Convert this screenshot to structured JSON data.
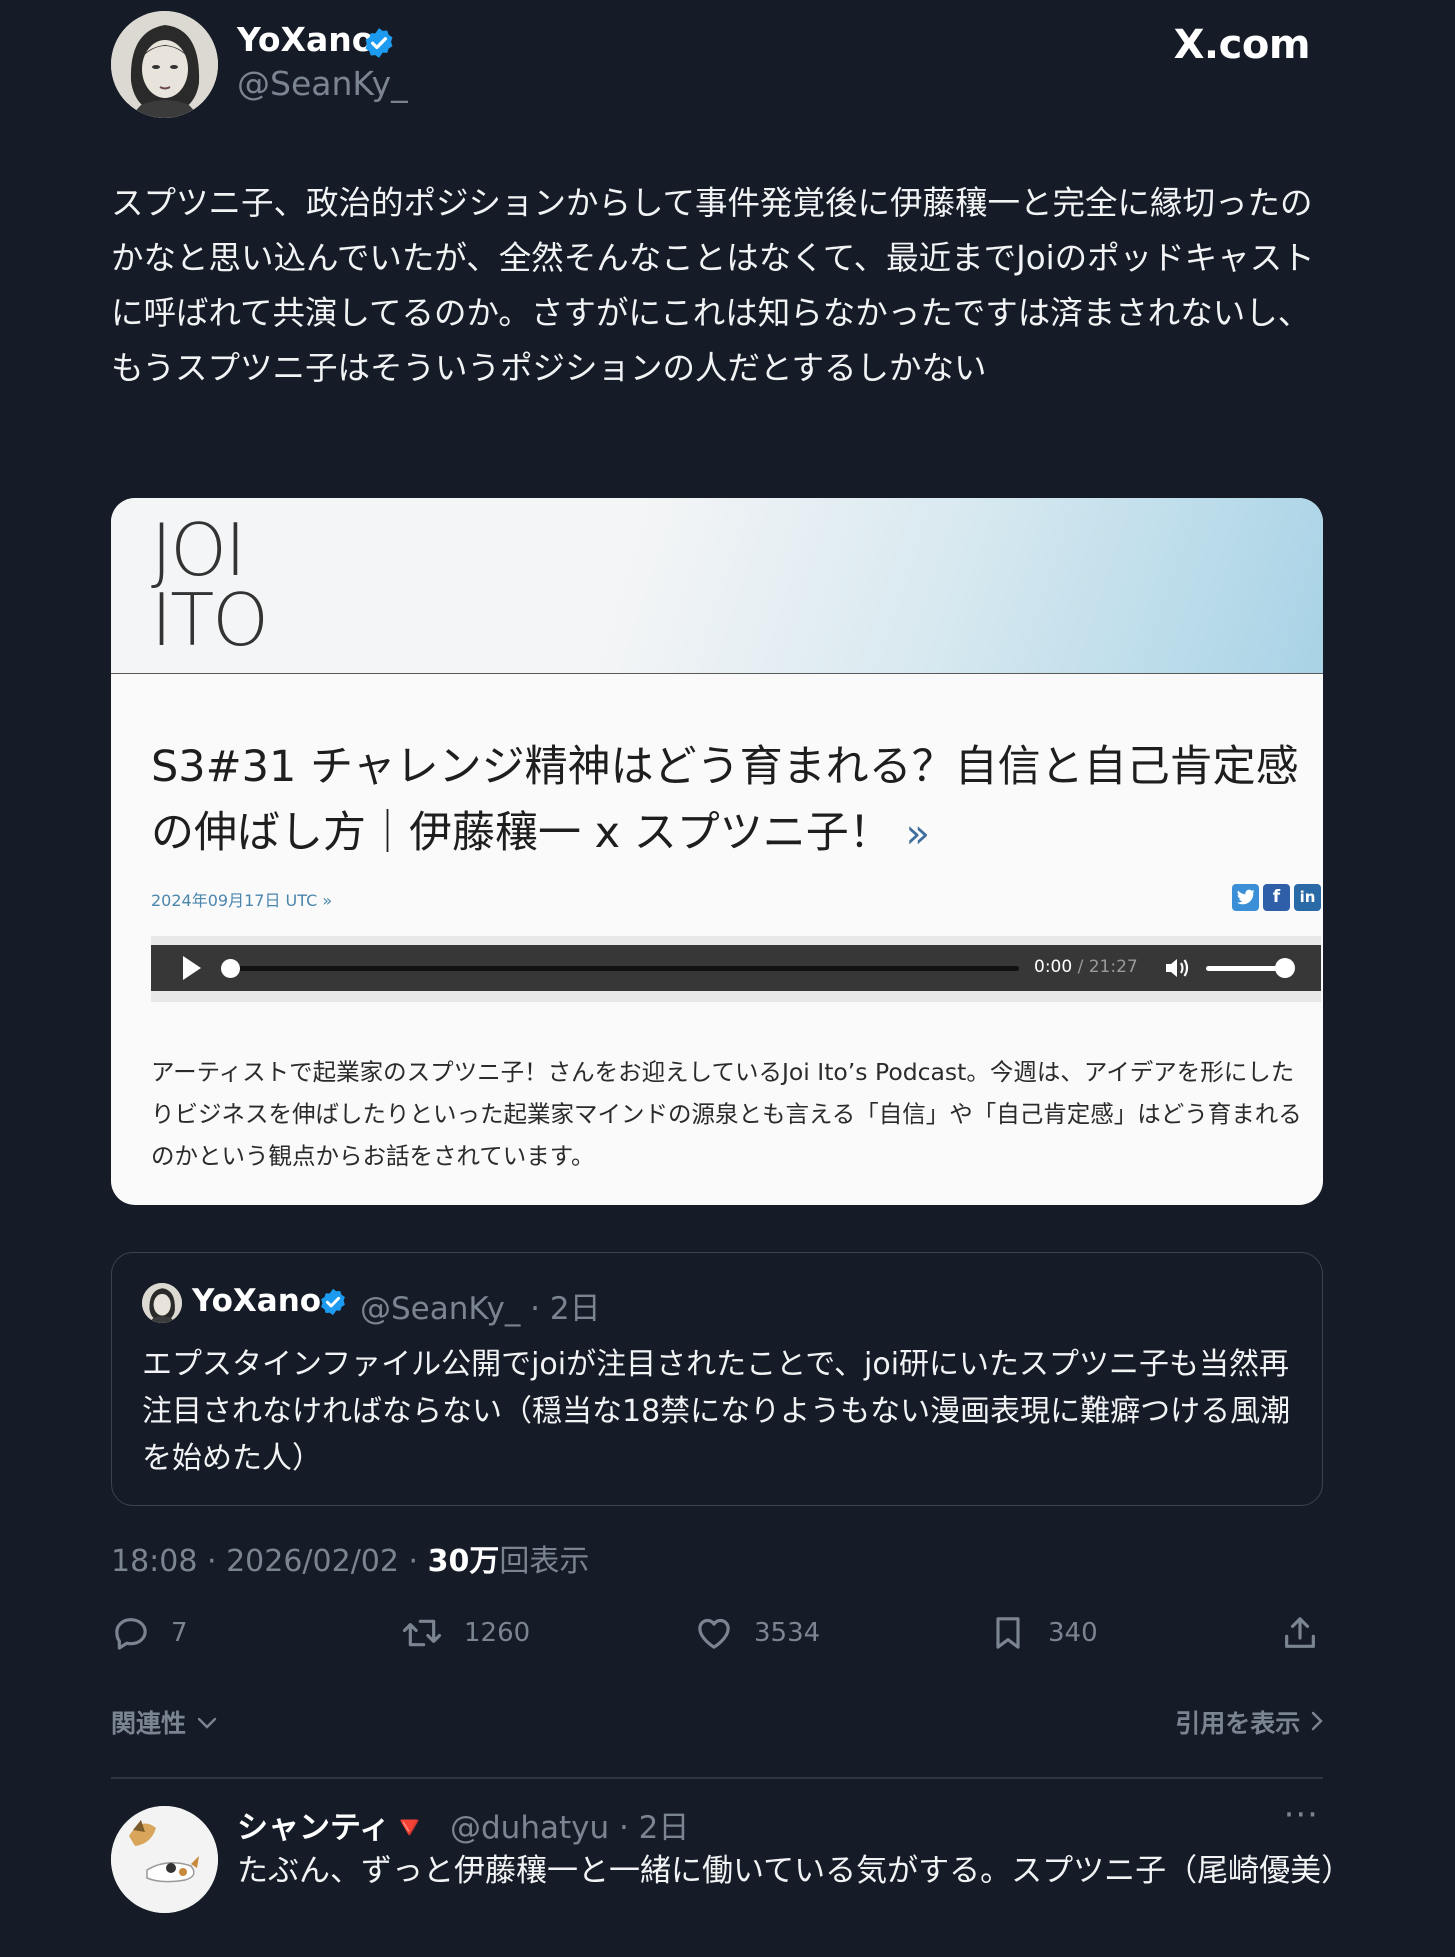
{
  "tweet": {
    "author_name": "YoXano",
    "author_handle": "@SeanKy_",
    "brand": "X.com",
    "text": "スプツニ子、政治的ポジションからして事件発覚後に伊藤穰一と完全に縁切ったのかなと思い込んでいたが、全然そんなことはなくて、最近までJoiのポッドキャストに呼ばれて共演してるのか。さすがにこれは知らなかったですは済まされないし、もうスプツニ子はそういうポジションの人だとするしかない"
  },
  "card": {
    "logo_line1": "JOI",
    "logo_line2": "ITO",
    "title": "S3#31 チャレンジ精神はどう育まれる？自信と自己肯定感の伸ばし方｜伊藤穰一 x スプツニ子！",
    "title_more": "»",
    "date": "2024年09月17日 UTC »",
    "share_icons": [
      "twitter-icon",
      "facebook-icon",
      "linkedin-icon"
    ],
    "player": {
      "current_time": "0:00",
      "duration": "/ 21:27",
      "progress": 0,
      "volume": 1
    },
    "description": "アーティストで起業家のスプツニ子！さんをお迎えしているJoi Ito’s Podcast。今週は、アイデアを形にしたりビジネスを伸ばしたりといった起業家マインドの源泉とも言える「自信」や「自己肯定感」はどう育まれるのかという観点からお話をされています。"
  },
  "quote": {
    "author_name": "YoXano",
    "author_handle": "@SeanKy_ · 2日",
    "text": "エプスタインファイル公開でjoiが注目されたことで、joi研にいたスプツニ子も当然再注目されなければならない（穏当な18禁になりようもない漫画表現に難癖つける風潮を始めた人）"
  },
  "meta": {
    "timestamp": "18:08 · 2026/02/02 · ",
    "views_count": "30万",
    "views_label": "回表示"
  },
  "actions": {
    "replies": "7",
    "retweets": "1260",
    "likes": "3534",
    "bookmarks": "340"
  },
  "controls": {
    "sort_label": "関連性",
    "quotes_label": "引用を表示"
  },
  "reply": {
    "author_name": "シャンティ🔻",
    "author_handle": "@duhatyu · 2日",
    "more": "···",
    "text": "たぶん、ずっと伊藤穰一と一緒に働いている気がする。スプツニ子（尾崎優美）"
  },
  "colors": {
    "background": "#161c27",
    "verified": "#1d9bf0",
    "muted": "#7b8591"
  }
}
